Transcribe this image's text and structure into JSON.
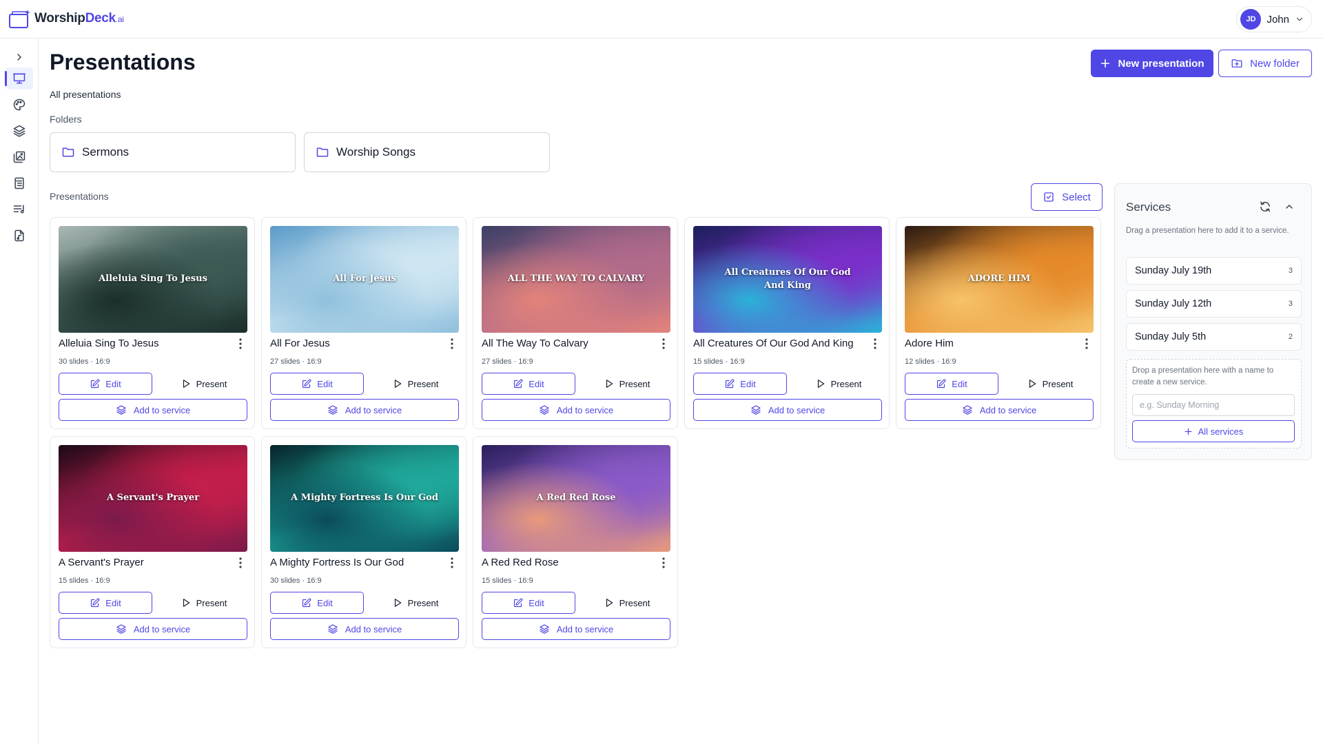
{
  "app": {
    "logo_name": "WorshipDeck",
    "logo_main": "Worship",
    "logo_accent": "Deck",
    "logo_suffix": ".ai"
  },
  "user": {
    "initials": "JD",
    "name": "John"
  },
  "header": {
    "title": "Presentations",
    "breadcrumb": "All presentations",
    "new_presentation_label": "New presentation",
    "new_folder_label": "New folder"
  },
  "sidebar": {
    "items": [
      {
        "icon": "chevron-right-icon"
      },
      {
        "icon": "presentation-icon",
        "active": true
      },
      {
        "icon": "palette-icon"
      },
      {
        "icon": "layers-icon"
      },
      {
        "icon": "images-icon"
      },
      {
        "icon": "list-icon"
      },
      {
        "icon": "setlist-icon"
      },
      {
        "icon": "song-file-icon"
      }
    ]
  },
  "folders": {
    "label": "Folders",
    "items": [
      {
        "name": "Sermons"
      },
      {
        "name": "Worship Songs"
      }
    ]
  },
  "presentations": {
    "label": "Presentations",
    "select_label": "Select",
    "edit_label": "Edit",
    "present_label": "Present",
    "add_label": "Add to service",
    "items": [
      {
        "title": "Alleluia Sing To Jesus",
        "thumb_text": "Alleluia Sing To Jesus",
        "meta": "30 slides · 16:9",
        "theme": "misty forest",
        "colors": [
          "#a9b8b5",
          "#3d5a55",
          "#1b2e2b"
        ]
      },
      {
        "title": "All For Jesus",
        "thumb_text": "All For Jesus",
        "meta": "27 slides · 16:9",
        "theme": "blue sky clouds",
        "colors": [
          "#5b9bc9",
          "#cfe6f2",
          "#8fc0dd"
        ]
      },
      {
        "title": "All The Way To Calvary",
        "thumb_text": "ALL THE WAY TO CALVARY",
        "meta": "27 slides · 16:9",
        "theme": "sunset clouds",
        "colors": [
          "#3b3f66",
          "#b06a8a",
          "#e3837a"
        ]
      },
      {
        "title": "All Creatures Of Our God And King",
        "thumb_text": "All Creatures Of Our God And King",
        "meta": "15 slides · 16:9",
        "theme": "purple galaxy clouds",
        "colors": [
          "#1b1f5a",
          "#7a2fc9",
          "#2ab3d8"
        ]
      },
      {
        "title": "Adore Him",
        "thumb_text": "ADORE HIM",
        "meta": "12 slides · 16:9",
        "theme": "golden fiery clouds",
        "colors": [
          "#2a1a12",
          "#e58a2a",
          "#f6c36a"
        ]
      },
      {
        "title": "A Servant's Prayer",
        "thumb_text": "A Servant's Prayer",
        "meta": "15 slides · 16:9",
        "theme": "crimson smoke",
        "colors": [
          "#1a0a18",
          "#c41e4a",
          "#7a1a4a"
        ]
      },
      {
        "title": "A Mighty Fortress Is Our God",
        "thumb_text": "A Mighty Fortress Is Our God",
        "meta": "30 slides · 16:9",
        "theme": "aurora",
        "colors": [
          "#06232a",
          "#1fa89a",
          "#0a4a5a"
        ]
      },
      {
        "title": "A Red Red Rose",
        "thumb_text": "A Red Red Rose",
        "meta": "15 slides · 16:9",
        "theme": "violet sunset clouds",
        "colors": [
          "#2a1e5a",
          "#8a5ac8",
          "#e89a7a"
        ]
      }
    ]
  },
  "services": {
    "title": "Services",
    "hint": "Drag a presentation here to add it to a service.",
    "items": [
      {
        "name": "Sunday July 19th",
        "count": "3"
      },
      {
        "name": "Sunday July 12th",
        "count": "3"
      },
      {
        "name": "Sunday July 5th",
        "count": "2"
      }
    ],
    "new_hint": "Drop a presentation here with a name to create a new service.",
    "input_placeholder": "e.g. Sunday Morning",
    "all_label": "All services"
  },
  "colors": {
    "accent": "#4f46e5",
    "border": "#e5e7eb",
    "text": "#111827",
    "muted": "#6b7280"
  }
}
